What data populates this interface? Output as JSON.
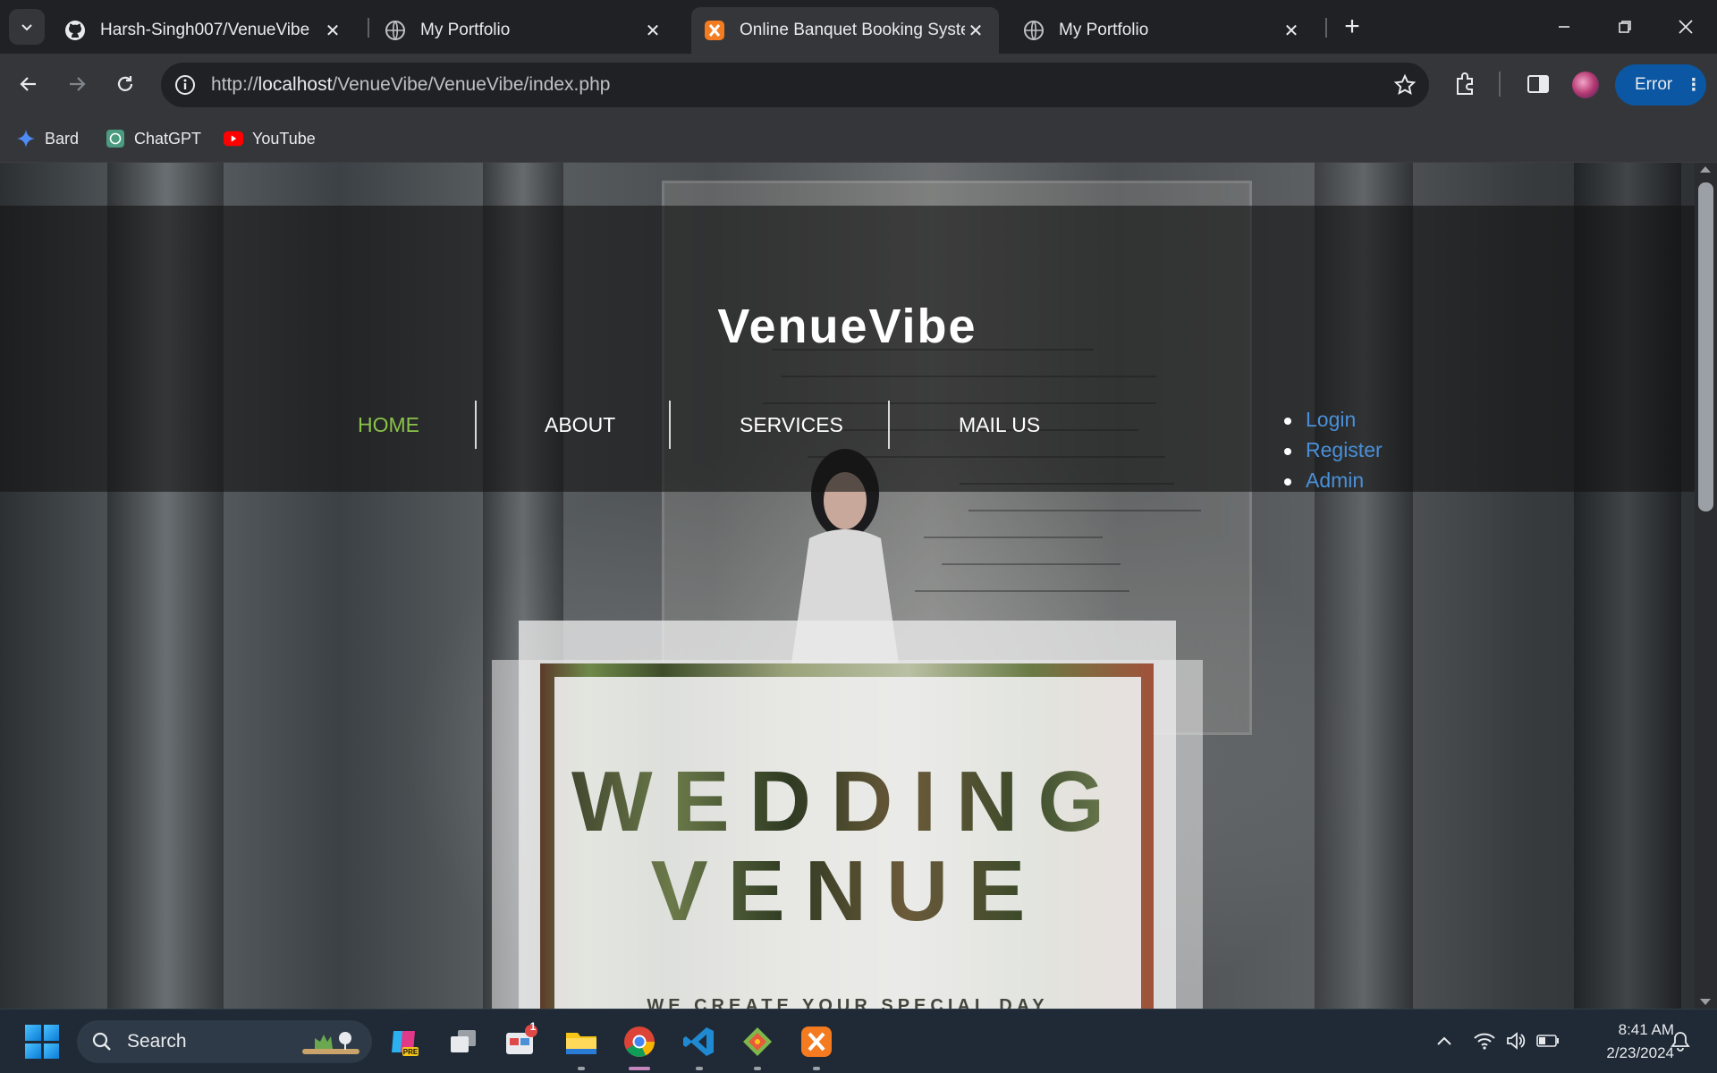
{
  "tabs": [
    {
      "title": "Harsh-Singh007/VenueVibe",
      "icon": "github-icon"
    },
    {
      "title": "My Portfolio",
      "icon": "globe-icon"
    },
    {
      "title": "Online Banquet Booking System",
      "icon": "xampp-icon",
      "active": true
    },
    {
      "title": "My Portfolio",
      "icon": "globe-icon"
    }
  ],
  "address_bar": {
    "url_prefix": "http://",
    "url_host": "localhost",
    "url_path": "/VenueVibe/VenueVibe/index.php"
  },
  "toolbar": {
    "error_label": "Error"
  },
  "bookmarks": [
    {
      "label": "Bard",
      "icon": "bard-icon"
    },
    {
      "label": "ChatGPT",
      "icon": "chatgpt-icon"
    },
    {
      "label": "YouTube",
      "icon": "youtube-icon"
    }
  ],
  "site": {
    "brand": "VenueVibe",
    "nav": [
      "HOME",
      "ABOUT",
      "SERVICES",
      "MAIL US"
    ],
    "auth_links": [
      "Login",
      "Register",
      "Admin"
    ],
    "hero": {
      "line1": "WEDDING",
      "line2": "VENUE",
      "tagline": "WE CREATE YOUR SPECIAL DAY"
    }
  },
  "taskbar": {
    "search_placeholder": "Search",
    "notification_badge": "1",
    "time": "8:41 AM",
    "date": "2/23/2024"
  },
  "colors": {
    "nav_active": "#8bc34a",
    "link": "#4a90d9",
    "error_button": "#0b57a3"
  }
}
